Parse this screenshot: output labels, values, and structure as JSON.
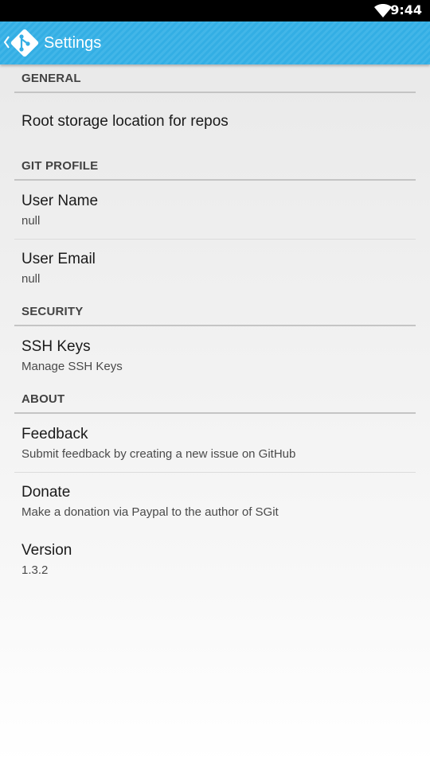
{
  "status_bar": {
    "time": "9:44",
    "wifi_icon": "wifi-icon"
  },
  "app_bar": {
    "title": "Settings",
    "back_icon": "chevron-left-icon",
    "logo_icon": "git-logo-icon"
  },
  "sections": {
    "general": {
      "header": "GENERAL",
      "items": [
        {
          "title": "Root storage location for repos"
        }
      ]
    },
    "git_profile": {
      "header": "GIT PROFILE",
      "items": [
        {
          "title": "User Name",
          "summary": "null"
        },
        {
          "title": "User Email",
          "summary": "null"
        }
      ]
    },
    "security": {
      "header": "SECURITY",
      "items": [
        {
          "title": "SSH Keys",
          "summary": "Manage SSH Keys"
        }
      ]
    },
    "about": {
      "header": "ABOUT",
      "items": [
        {
          "title": "Feedback",
          "summary": "Submit feedback by creating a new issue on GitHub"
        },
        {
          "title": "Donate",
          "summary": "Make a donation via Paypal to the author of SGit"
        },
        {
          "title": "Version",
          "summary": "1.3.2"
        }
      ]
    }
  },
  "colors": {
    "app_bar": "#33aee4",
    "status_bar": "#000000",
    "header_text": "#424242"
  }
}
